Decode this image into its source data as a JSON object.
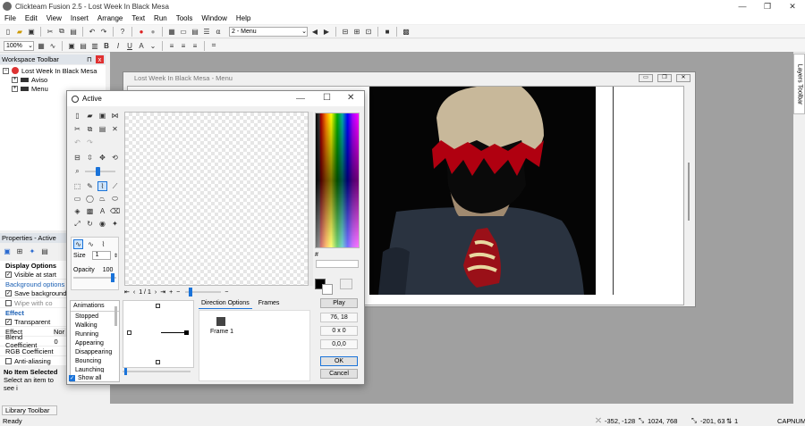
{
  "app": {
    "title": "Clickteam Fusion 2.5 - Lost Week In Black Mesa",
    "min": "—",
    "max": "❐",
    "close": "✕"
  },
  "menu": [
    "File",
    "Edit",
    "View",
    "Insert",
    "Arrange",
    "Text",
    "Run",
    "Tools",
    "Window",
    "Help"
  ],
  "toolbar": {
    "frame_select": "2 - Menu",
    "zoom": "100%"
  },
  "workspace": {
    "title": "Workspace Toolbar",
    "pin": "⊓",
    "close": "x",
    "root": "Lost Week In Black Mesa",
    "items": [
      "Aviso",
      "Menu"
    ]
  },
  "properties": {
    "title": "Properties - Active",
    "display_options": "Display Options",
    "visible_at_start": "Visible at start",
    "background_options": "Background options",
    "save_background": "Save background",
    "wipe_with_color": "Wipe with co",
    "effect_section": "Effect",
    "transparent": "Transparent",
    "effect_label": "Effect",
    "effect_value": "Nor",
    "blend_label": "Blend Coefficient",
    "blend_value": "0",
    "rgb_label": "RGB Coefficient",
    "antialias": "Anti-aliasing",
    "no_item_title": "No Item Selected",
    "no_item_desc": "Select an item to see i"
  },
  "library": {
    "title": "Library Toolbar"
  },
  "layers": {
    "title": "Layers Toolbar"
  },
  "frame_window": {
    "title": "Lost Week In Black Mesa - Menu"
  },
  "editor": {
    "title": "Active",
    "size_label": "Size",
    "size_value": "1",
    "opacity_label": "Opacity",
    "opacity_value": "100",
    "frame_counter": "1 / 1",
    "anim_header": "Animations",
    "animations": [
      "Stopped",
      "Walking",
      "Running",
      "Appearing",
      "Disappearing",
      "Bouncing",
      "Launching"
    ],
    "show_all": "Show all",
    "tab_direction": "Direction Options",
    "tab_frames": "Frames",
    "frame_item": "Frame 1",
    "play": "Play",
    "hotspot": "76, 18",
    "size_field": "0 x 0",
    "action": "0,0,0",
    "ok": "OK",
    "cancel": "Cancel",
    "hash": "#"
  },
  "statusbar": {
    "ready": "Ready",
    "coords": "-352, -128",
    "resolution": "1024, 768",
    "pos2": "-201, 63",
    "layer": "1",
    "caps": "CAP",
    "num": "NUM"
  }
}
